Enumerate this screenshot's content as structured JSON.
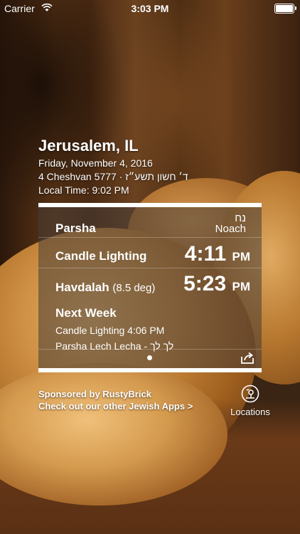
{
  "status": {
    "carrier": "Carrier",
    "time": "3:03 PM"
  },
  "header": {
    "city": "Jerusalem, IL",
    "date": "Friday, November 4, 2016",
    "hebrew_date": "4 Cheshvan 5777 · ד׳ חשון תשע״ז",
    "local_time": "Local Time: 9:02 PM"
  },
  "panel": {
    "parsha_label": "Parsha",
    "parsha_hebrew": "נח",
    "parsha_name": "Noach",
    "candle_label": "Candle Lighting",
    "candle_time": "4:11",
    "candle_ampm": "PM",
    "havdalah_label": "Havdalah",
    "havdalah_sub": "(8.5 deg)",
    "havdalah_time": "5:23",
    "havdalah_ampm": "PM",
    "next_week_title": "Next Week",
    "next_candle": "Candle Lighting 4:06 PM",
    "next_parsha": "Parsha Lech Lecha - לך לך"
  },
  "footer": {
    "sponsor_line1": "Sponsored by RustyBrick",
    "sponsor_line2": "Check out our other Jewish Apps >",
    "locations_label": "Locations"
  }
}
